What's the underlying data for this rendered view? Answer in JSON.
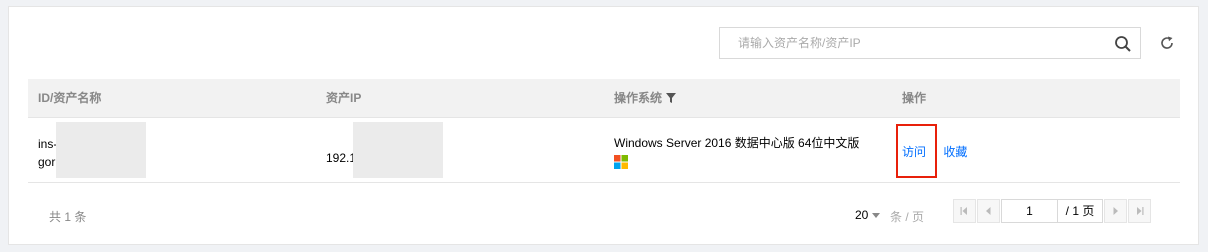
{
  "search": {
    "placeholder": "请输入资产名称/资产IP",
    "value": ""
  },
  "table": {
    "headers": {
      "id_name": "ID/资产名称",
      "ip": "资产IP",
      "os": "操作系统",
      "actions": "操作"
    },
    "rows": [
      {
        "id_line1": "ins-",
        "id_line2": "gor",
        "ip": "192.1",
        "os": "Windows Server 2016 数据中心版 64位中文版",
        "os_icon": "windows-logo-icon",
        "action_visit": "访问",
        "action_favorite": "收藏"
      }
    ]
  },
  "footer": {
    "total": "共 1 条",
    "page_size": "20",
    "per_page_label": "条 / 页",
    "current_page": "1",
    "total_pages": "/ 1 页"
  },
  "colors": {
    "link": "#006eff",
    "highlight": "#e8200a",
    "header_bg": "#f2f2f2"
  }
}
